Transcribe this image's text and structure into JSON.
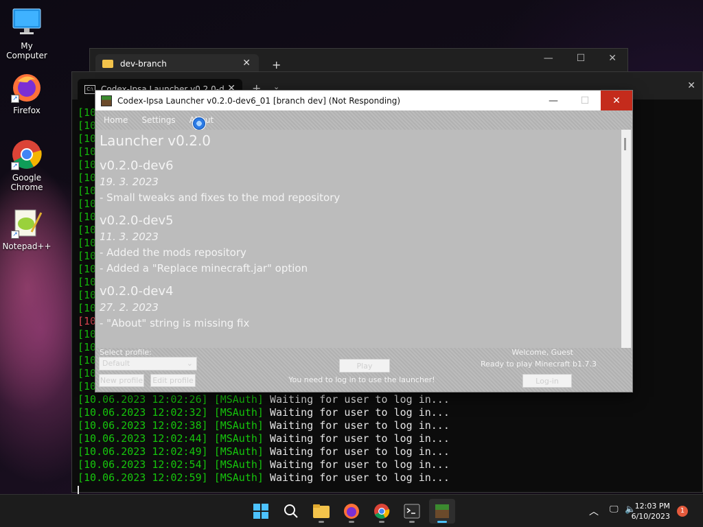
{
  "desktop": {
    "icons": [
      {
        "label": "My Computer",
        "icon": "monitor-icon"
      },
      {
        "label": "Firefox",
        "icon": "firefox-icon"
      },
      {
        "label": "Google Chrome",
        "icon": "chrome-icon"
      },
      {
        "label": "Notepad++",
        "icon": "notepadpp-icon"
      }
    ]
  },
  "explorer": {
    "tab_label": "dev-branch",
    "close_glyph": "✕",
    "new_tab_glyph": "+"
  },
  "terminal": {
    "tab_label": "Codex-Ipsa Launcher v0.2.0-d",
    "icon_text": "C:\\",
    "close_glyph": "✕",
    "new_tab_glyph": "+",
    "dropdown_glyph": "⌄",
    "partial_lines": [
      "[10",
      "[10",
      "[10",
      "[10",
      "[10",
      "[10",
      "[10",
      "[10",
      "[10",
      "[10",
      "[10",
      "[10",
      "[10",
      "[10",
      "[10",
      "[10",
      "[10",
      "[10",
      "[10",
      "[10",
      "[10",
      "[10"
    ],
    "partial_err_index": 16,
    "lines": [
      {
        "ts": "[10.06.2023 12:02:26]",
        "tag": "[MSAuth]",
        "msg": "Waiting for user to log in..."
      },
      {
        "ts": "[10.06.2023 12:02:32]",
        "tag": "[MSAuth]",
        "msg": "Waiting for user to log in..."
      },
      {
        "ts": "[10.06.2023 12:02:38]",
        "tag": "[MSAuth]",
        "msg": "Waiting for user to log in..."
      },
      {
        "ts": "[10.06.2023 12:02:44]",
        "tag": "[MSAuth]",
        "msg": "Waiting for user to log in..."
      },
      {
        "ts": "[10.06.2023 12:02:49]",
        "tag": "[MSAuth]",
        "msg": "Waiting for user to log in..."
      },
      {
        "ts": "[10.06.2023 12:02:54]",
        "tag": "[MSAuth]",
        "msg": "Waiting for user to log in..."
      },
      {
        "ts": "[10.06.2023 12:02:59]",
        "tag": "[MSAuth]",
        "msg": "Waiting for user to log in..."
      }
    ]
  },
  "launcher": {
    "title": "Codex-Ipsa Launcher v0.2.0-dev6_01 [branch dev] (Not Responding)",
    "menu": [
      "Home",
      "Settings",
      "About"
    ],
    "heading": "Launcher v0.2.0",
    "changelog": [
      {
        "version": "v0.2.0-dev6",
        "date": "19. 3. 2023",
        "items": [
          "- Small tweaks and fixes to the mod repository"
        ]
      },
      {
        "version": "v0.2.0-dev5",
        "date": "11. 3. 2023",
        "items": [
          "- Added the mods repository",
          "- Added a \"Replace minecraft.jar\" option"
        ]
      },
      {
        "version": "v0.2.0-dev4",
        "date": "27. 2. 2023",
        "items": [
          "- \"About\" string is missing fix"
        ]
      }
    ],
    "bottom": {
      "select_profile_label": "Select profile:",
      "profile_value": "Default",
      "new_profile": "New profile",
      "edit_profile": "Edit profile",
      "play": "Play",
      "login_notice": "You need to log in to use the launcher!",
      "welcome": "Welcome, Guest",
      "ready": "Ready to play Minecraft b1.7.3",
      "login": "Log-in"
    }
  },
  "taskbar": {
    "apps": [
      "start-icon",
      "search-icon",
      "file-explorer-icon",
      "firefox-icon",
      "chrome-icon",
      "terminal-icon",
      "minecraft-launcher-icon"
    ],
    "time": "12:03 PM",
    "date": "6/10/2023",
    "notification_count": "1"
  }
}
